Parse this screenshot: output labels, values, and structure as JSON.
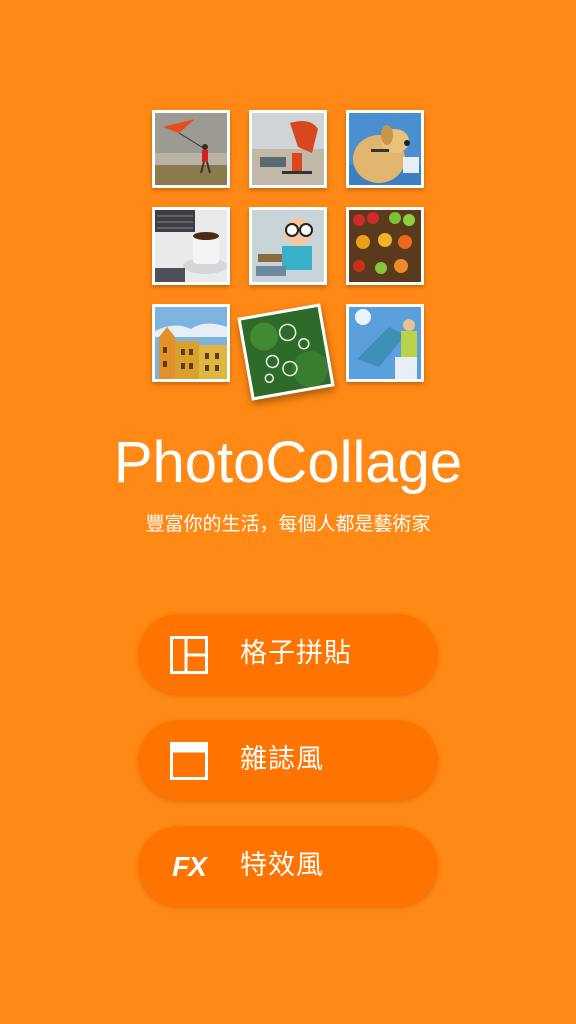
{
  "app": {
    "title": "PhotoCollage",
    "tagline": "豐富你的生活，每個人都是藝術家"
  },
  "thumbnails": [
    {
      "name": "kite"
    },
    {
      "name": "skateboard"
    },
    {
      "name": "dog"
    },
    {
      "name": "coffee"
    },
    {
      "name": "goggles-kid"
    },
    {
      "name": "fruit"
    },
    {
      "name": "buildings"
    },
    {
      "name": "bubbles"
    },
    {
      "name": "sky-woman"
    }
  ],
  "menu": {
    "items": [
      {
        "label": "格子拼貼",
        "icon": "grid-layout-icon"
      },
      {
        "label": "雜誌風",
        "icon": "magazine-layout-icon"
      },
      {
        "label": "特效風",
        "icon": "fx-icon",
        "icon_text": "FX"
      }
    ]
  },
  "colors": {
    "background": "#FF8914",
    "button": "#FF7300",
    "text": "#FFFFFF"
  }
}
